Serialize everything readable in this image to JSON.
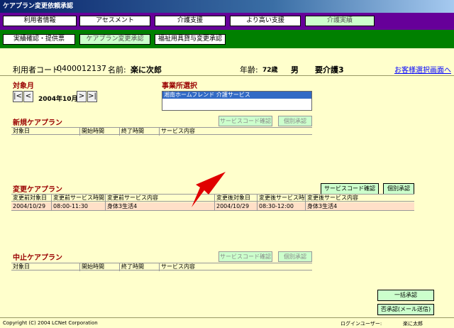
{
  "window": {
    "title": "ケアプラン変更依頼承認"
  },
  "nav_main": {
    "items": [
      {
        "label": "利用者情報"
      },
      {
        "label": "アセスメント"
      },
      {
        "label": "介護支援"
      },
      {
        "label": "より高い支援"
      },
      {
        "label": "介護実績"
      }
    ]
  },
  "nav_sub": {
    "items": [
      {
        "label": "実績確認・提供票"
      },
      {
        "label": "ケアプラン変更承認"
      },
      {
        "label": "福祉用具貸与変更承認"
      }
    ]
  },
  "user": {
    "code_label": "利用者コード:",
    "code": "0400012137",
    "name_label": "名前:",
    "name": "楽に次郎",
    "age_label": "年齢:",
    "age": "72歳",
    "gender": "男",
    "care_level": "要介護3",
    "customer_select_link": "お客様選択画面へ"
  },
  "target_month": {
    "label": "対象月",
    "first": "|<",
    "prev": "<",
    "value": "2004年10月",
    "next": ">",
    "last": ">|"
  },
  "office": {
    "label": "事業所選択",
    "selected": "湘南ホームフレンド 介護サービス"
  },
  "new_plan": {
    "title": "新規ケアプラン",
    "service_code_button": "サービスコード確認",
    "individual_approve_button": "個別承認",
    "columns": [
      "対象日",
      "開始時間",
      "終了時間",
      "サービス内容"
    ]
  },
  "changed_plan": {
    "title": "変更ケアプラン",
    "service_code_button": "サービスコード確認",
    "individual_approve_button": "個別承認",
    "columns": [
      "変更前対象日",
      "変更前サービス時間",
      "変更前サービス内容",
      "変更後対象日",
      "変更後サービス時間",
      "変更後サービス内容"
    ],
    "rows": [
      [
        "2004/10/29",
        "08:00-11:30",
        "身体3生活4",
        "2004/10/29",
        "08:30-12:00",
        "身体3生活4"
      ]
    ]
  },
  "cancel_plan": {
    "title": "中止ケアプラン",
    "service_code_button": "サービスコード確認",
    "individual_approve_button": "個別承認",
    "columns": [
      "対象日",
      "開始時間",
      "終了時間",
      "サービス内容"
    ]
  },
  "actions": {
    "bulk_approve": "一括承認",
    "reject_with_mail": "否承認(メール送信)"
  },
  "footer": {
    "copyright": "Copyright (C) 2004 LCNet Corporation",
    "login_label": "ログインユーザー:",
    "login_user": "楽に太郎"
  },
  "colors": {
    "nav_main_bg": "#660099",
    "nav_sub_bg": "#008000",
    "page_bg": "#ffffcc",
    "section_title": "#990000",
    "changed_row_bg": "#ffe0c8",
    "arrow": "#e00000"
  }
}
